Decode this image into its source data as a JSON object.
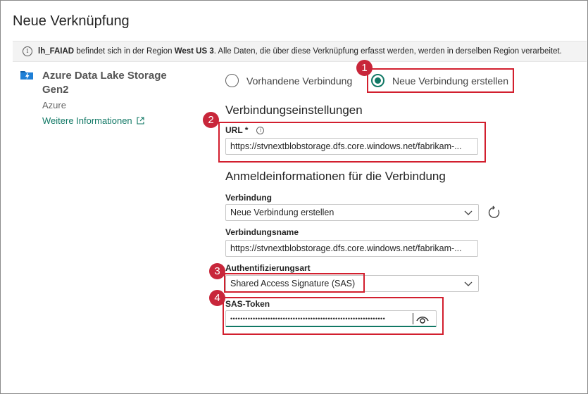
{
  "dialog": {
    "title": "Neue Verknüpfung"
  },
  "infobar": {
    "lakehouse": "lh_FAIAD",
    "text_1": " befindet sich in der Region ",
    "region": "West US 3",
    "text_2": ". Alle Daten, die über diese Verknüpfung erfasst werden, werden in derselben Region verarbeitet."
  },
  "source": {
    "name": "Azure Data Lake Storage Gen2",
    "category": "Azure",
    "more_info_link": "Weitere Informationen"
  },
  "connection_choice": {
    "existing_label": "Vorhandene Verbindung",
    "new_label": "Neue Verbindung erstellen",
    "selected": "new"
  },
  "connection_settings": {
    "heading": "Verbindungseinstellungen",
    "url_label": "URL *",
    "url_value": "https://stvnextblobstorage.dfs.core.windows.net/fabrikam-..."
  },
  "credentials": {
    "heading": "Anmeldeinformationen für die Verbindung",
    "connection_label": "Verbindung",
    "connection_value": "Neue Verbindung erstellen",
    "connection_name_label": "Verbindungsname",
    "connection_name_value": "https://stvnextblobstorage.dfs.core.windows.net/fabrikam-...",
    "auth_label": "Authentifizierungsart",
    "auth_value": "Shared Access Signature (SAS)",
    "sas_label": "SAS-Token",
    "sas_value": "••••••••••••••••••••••••••••••••••••••••••••••••••••••••••••••"
  },
  "annotations": {
    "b1": "1",
    "b2": "2",
    "b3": "3",
    "b4": "4"
  },
  "colors": {
    "accent": "#117865",
    "highlight": "#d21f2e",
    "badge": "#c8263a"
  }
}
